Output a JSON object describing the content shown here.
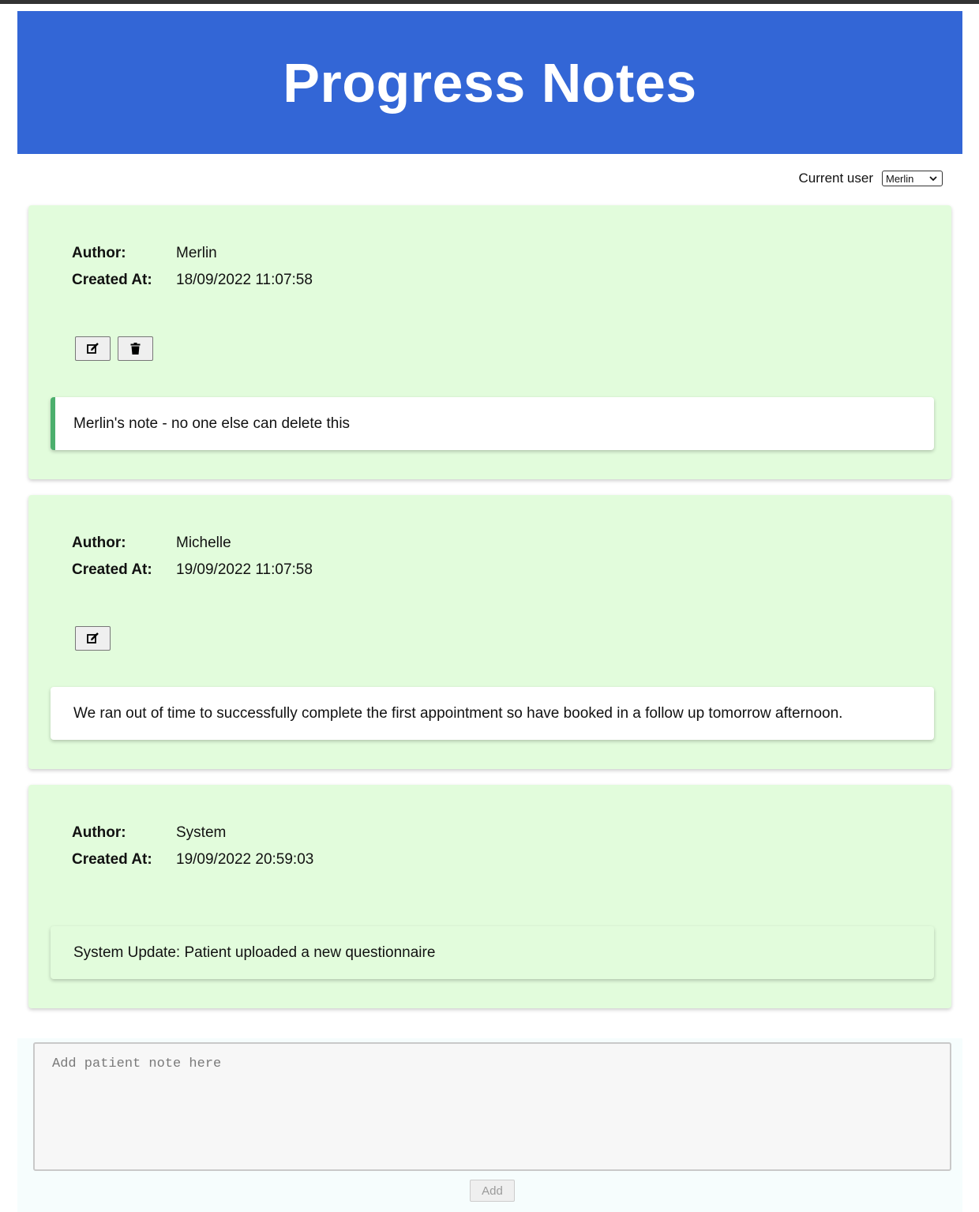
{
  "header": {
    "title": "Progress Notes"
  },
  "user_picker": {
    "label": "Current user",
    "selected": "Merlin"
  },
  "labels": {
    "author": "Author:",
    "created_at": "Created At:"
  },
  "notes": [
    {
      "author": "Merlin",
      "created_at": "18/09/2022 11:07:58",
      "text": "Merlin's note - no one else can delete this",
      "can_edit": true,
      "can_delete": true
    },
    {
      "author": "Michelle",
      "created_at": "19/09/2022 11:07:58",
      "text": "We ran out of time to successfully complete the first appointment so have booked in a follow up tomorrow afternoon.",
      "can_edit": true,
      "can_delete": false
    },
    {
      "author": "System",
      "created_at": "19/09/2022 20:59:03",
      "text": "System Update: Patient uploaded a new questionnaire",
      "can_edit": false,
      "can_delete": false
    }
  ],
  "composer": {
    "placeholder": "Add patient note here",
    "value": "",
    "add_label": "Add"
  },
  "colors": {
    "header_bg": "#3366d6",
    "card_bg": "#e2fcdc",
    "owner_accent": "#4caf6d"
  },
  "icons": {
    "edit": "edit-icon",
    "delete": "trash-icon",
    "dropdown": "chevron-down-icon"
  }
}
